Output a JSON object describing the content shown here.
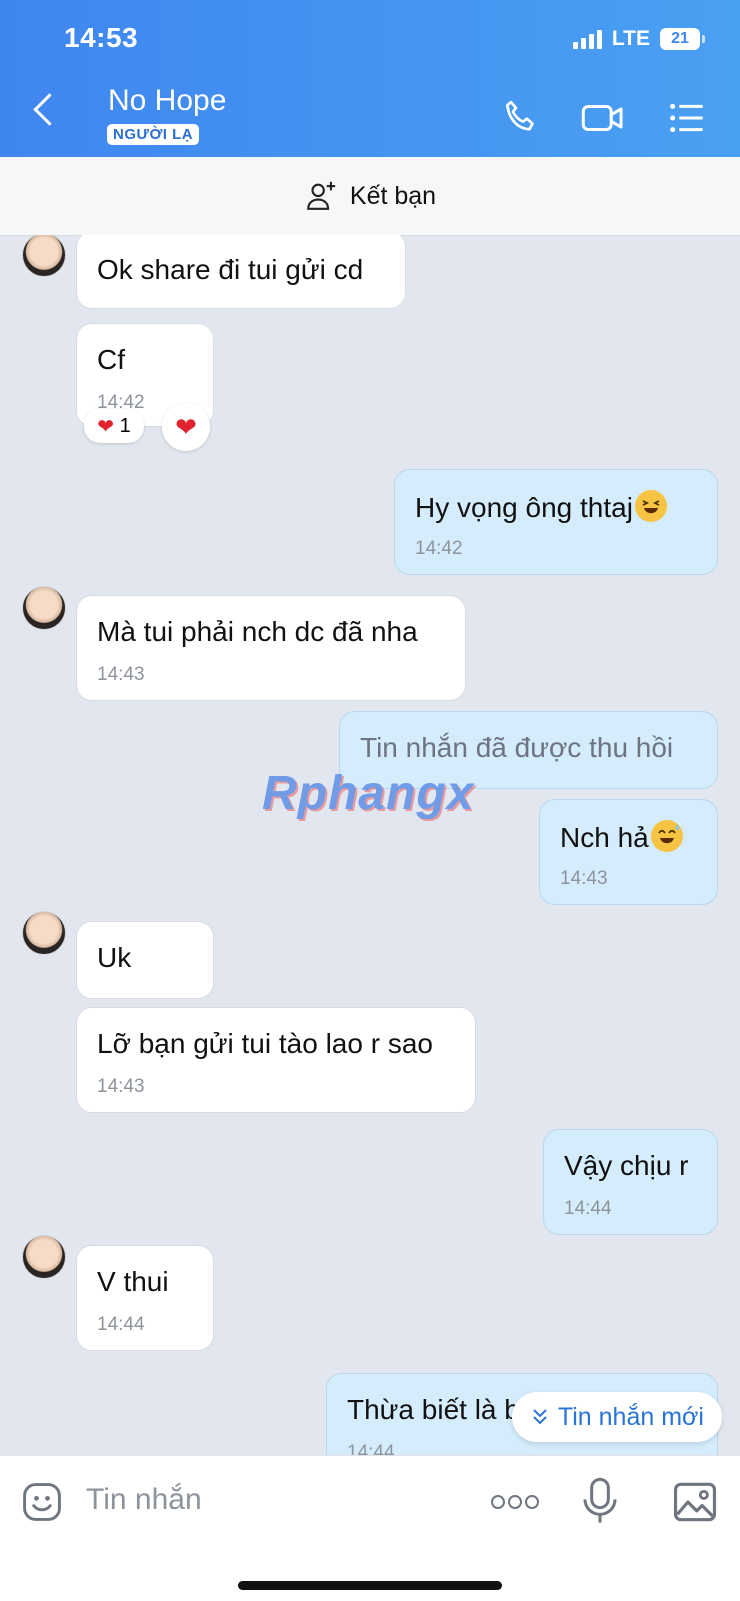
{
  "status_bar": {
    "time": "14:53",
    "network": "LTE",
    "battery": "21"
  },
  "header": {
    "contact_name": "No Hope",
    "badge": "NGƯỜI LẠ"
  },
  "add_friend_label": "Kết bạn",
  "messages": [
    {
      "side": "in",
      "text": "Ok share đi tui gửi cd",
      "time": ""
    },
    {
      "side": "in",
      "text": "Cf",
      "time": "14:42",
      "reaction_count": "1"
    },
    {
      "side": "out",
      "text": "Hy vọng ông thtaj",
      "time": "14:42",
      "emoji": "laughing"
    },
    {
      "side": "in",
      "text": "Mà tui phải nch dc đã nha",
      "time": "14:43"
    },
    {
      "side": "out",
      "text": "Tin nhắn đã được thu hồi",
      "time": "",
      "recalled": true
    },
    {
      "side": "out",
      "text": "Nch hả",
      "time": "14:43",
      "emoji": "sweat-smile"
    },
    {
      "side": "in",
      "text": "Uk",
      "time": ""
    },
    {
      "side": "in",
      "text": "Lỡ bạn gửi tui tào lao r sao",
      "time": "14:43"
    },
    {
      "side": "out",
      "text": "Vậy chịu r",
      "time": "14:44"
    },
    {
      "side": "in",
      "text": "V thui",
      "time": "14:44"
    },
    {
      "side": "out",
      "text": "Thừa biết là b",
      "time": "14:44"
    }
  ],
  "watermark": "Rphangx",
  "new_messages_label": "Tin nhắn mới",
  "input": {
    "placeholder": "Tin nhắn"
  },
  "colors": {
    "header_start": "#3f86ef",
    "header_end": "#4aa0f2",
    "outgoing_bubble": "#d4ecfb",
    "background": "#e2e6ee",
    "link": "#2874d6"
  },
  "icons": [
    "back-icon",
    "phone-icon",
    "video-call-icon",
    "menu-icon",
    "add-person-icon",
    "heart-icon",
    "sticker-icon",
    "more-icon",
    "microphone-icon",
    "image-icon",
    "double-chevron-down-icon"
  ]
}
